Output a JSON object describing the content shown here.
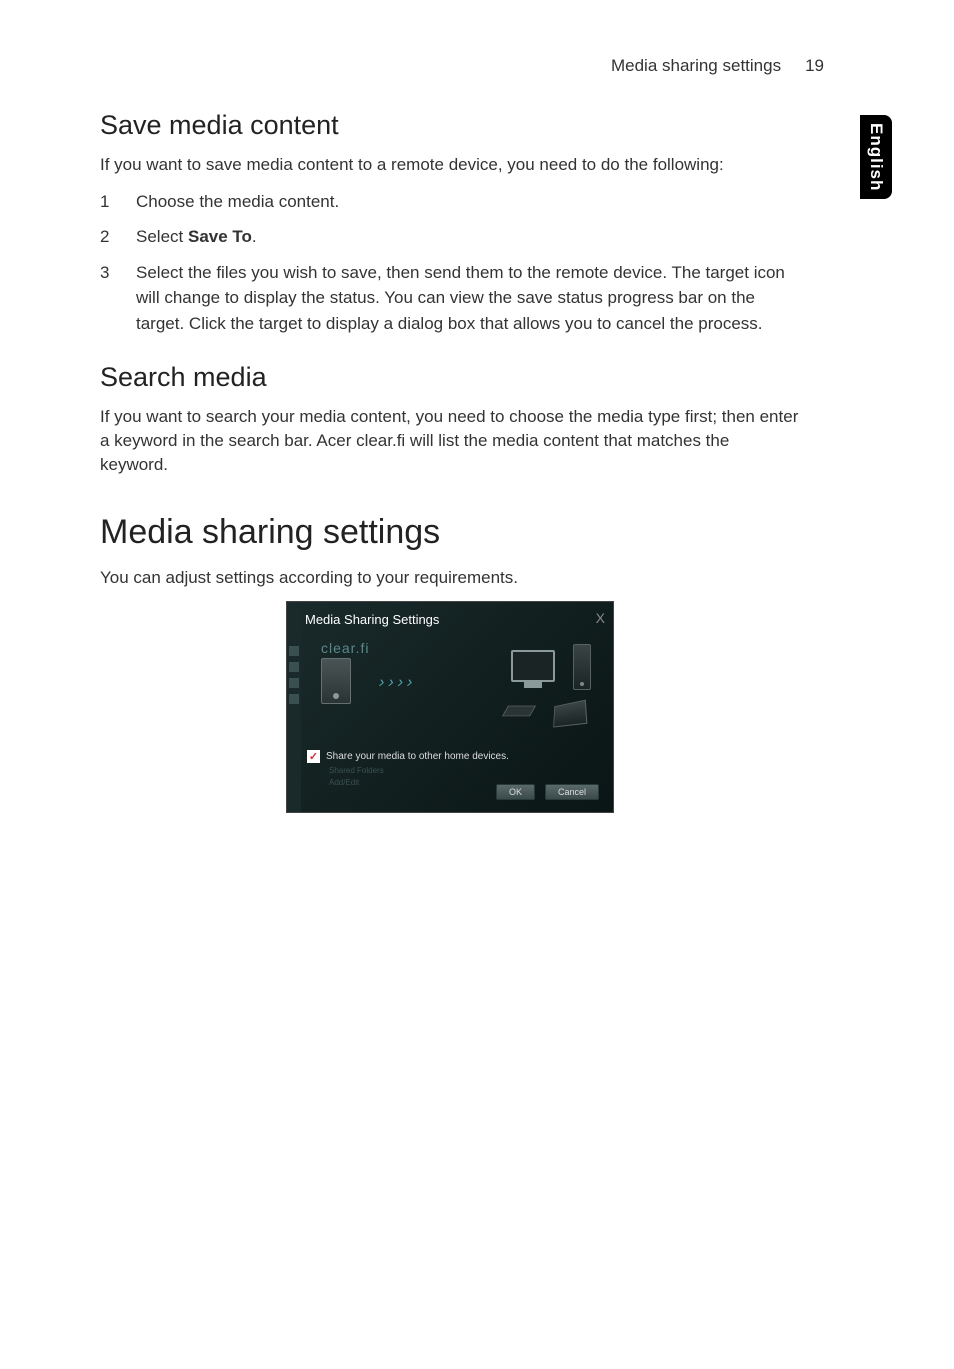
{
  "header": {
    "title": "Media sharing settings",
    "page_number": "19"
  },
  "side_tab": "English",
  "section1": {
    "heading": "Save media content",
    "intro": "If you want to save media content to a remote device, you need to do the following:",
    "steps": [
      {
        "num": "1",
        "text_a": "Choose the media content.",
        "bold": "",
        "text_b": ""
      },
      {
        "num": "2",
        "text_a": "Select ",
        "bold": "Save To",
        "text_b": "."
      },
      {
        "num": "3",
        "text_a": "Select the files you wish to save, then send them to the remote device. The target icon will change to display the status. You can view the save status progress bar on the target. Click the target to display a dialog box that allows you to cancel the process.",
        "bold": "",
        "text_b": ""
      }
    ]
  },
  "section2": {
    "heading": "Search media",
    "body": "If you want to search your media content, you need to choose the media type first; then enter a keyword in the search bar. Acer clear.fi will list the media content that matches the keyword."
  },
  "section3": {
    "heading": "Media sharing settings",
    "body": "You can adjust settings according to your requirements."
  },
  "dialog": {
    "title": "Media Sharing Settings",
    "logo": "clear.fi",
    "checkbox_label": "Share your media to other home devices.",
    "checkbox_checked": "✓",
    "shared_folders": "Shared Folders",
    "add_edit": "Add/Edit",
    "ok": "OK",
    "cancel": "Cancel",
    "close": "X"
  }
}
